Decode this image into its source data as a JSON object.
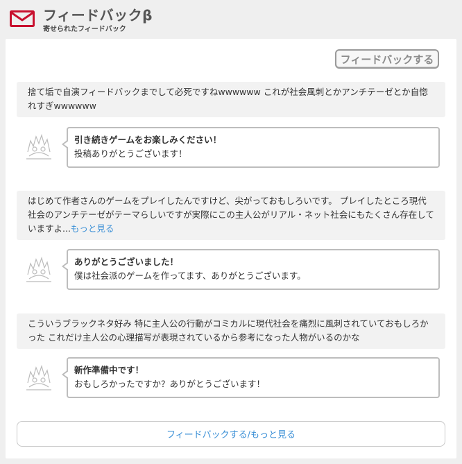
{
  "header": {
    "title": "フィードバックβ",
    "subtitle": "寄せられたフィードバック",
    "icon": "envelope-icon",
    "accent_color": "#c8102e"
  },
  "actions": {
    "feedback_button": "フィードバックする",
    "bottom_button": "フィードバックする/もっと見る"
  },
  "feedback": [
    {
      "comment": "捨て垢で自演フィードバックまでして必死ですねwwwwww これが社会風刺とかアンチテーゼとか自惚れすぎwwwwww",
      "more": "",
      "reply_title": "引き続きゲームをお楽しみください！",
      "reply_body": "投稿ありがとうございます！"
    },
    {
      "comment": "はじめて作者さんのゲームをプレイしたんですけど、尖がっておもしろいです。 プレイしたところ現代社会のアンチテーゼがテーマらしいですが実際にこの主人公がリアル・ネット社会にもたくさん存在していますよ...",
      "more": "もっと見る",
      "reply_title": "ありがとうございました！",
      "reply_body": "僕は社会派のゲームを作ってます、ありがとうございます。"
    },
    {
      "comment": "こういうブラックネタ好み 特に主人公の行動がコミカルに現代社会を痛烈に風刺されていておもしろかった これだけ主人公の心理描写が表現されているから参考になった人物がいるのかな",
      "more": "",
      "reply_title": "新作準備中です！",
      "reply_body": "おもしろかったですか？ありがとうございます！"
    }
  ]
}
